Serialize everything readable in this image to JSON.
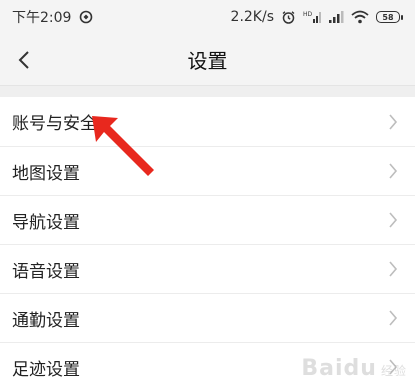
{
  "status_bar": {
    "time": "下午2:09",
    "network_speed": "2.2K/s",
    "battery_level": "58",
    "icons": [
      "app-notification-icon",
      "alarm-icon",
      "hd-signal-icon",
      "cell-signal-icon",
      "wifi-icon",
      "battery-icon"
    ]
  },
  "header": {
    "title": "设置",
    "back_icon": "chevron-left-icon"
  },
  "settings": {
    "items": [
      {
        "label": "账号与安全"
      },
      {
        "label": "地图设置"
      },
      {
        "label": "导航设置"
      },
      {
        "label": "语音设置"
      },
      {
        "label": "通勤设置"
      },
      {
        "label": "足迹设置"
      }
    ]
  },
  "annotation": {
    "color": "#e8281e",
    "icon": "red-arrow"
  },
  "watermark": {
    "text": "Baidu",
    "subtext": "经验"
  },
  "colors": {
    "background": "#efefef",
    "row_bg": "#ffffff",
    "chevron": "#bdbdbd"
  }
}
